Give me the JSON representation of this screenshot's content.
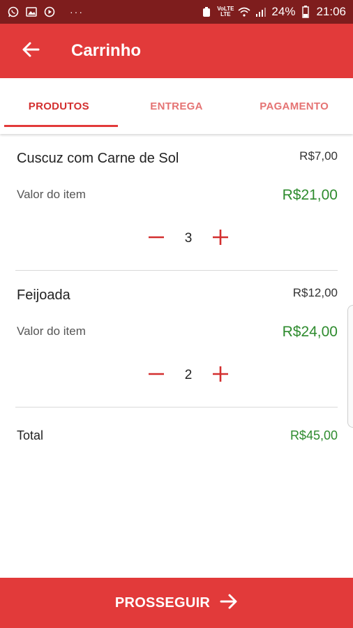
{
  "status_bar": {
    "icons": [
      "whatsapp-icon",
      "image-icon",
      "play-icon"
    ],
    "more": "···",
    "volte_top": "VoLTE",
    "volte_bottom": "LTE",
    "battery": "24%",
    "time": "21:06"
  },
  "header": {
    "title": "Carrinho"
  },
  "tabs": [
    {
      "label": "PRODUTOS",
      "active": true
    },
    {
      "label": "ENTREGA",
      "active": false
    },
    {
      "label": "PAGAMENTO",
      "active": false
    }
  ],
  "items": [
    {
      "name": "Cuscuz com Carne de Sol",
      "unit_price": "R$7,00",
      "total_label": "Valor do item",
      "total": "R$21,00",
      "quantity": "3"
    },
    {
      "name": "Feijoada",
      "unit_price": "R$12,00",
      "total_label": "Valor do item",
      "total": "R$24,00",
      "quantity": "2"
    }
  ],
  "summary": {
    "label": "Total",
    "value": "R$45,00"
  },
  "footer": {
    "button_label": "PROSSEGUIR"
  },
  "colors": {
    "primary": "#e23a3a",
    "status_bar": "#7e1d1d",
    "price_green": "#2e8b2e"
  }
}
